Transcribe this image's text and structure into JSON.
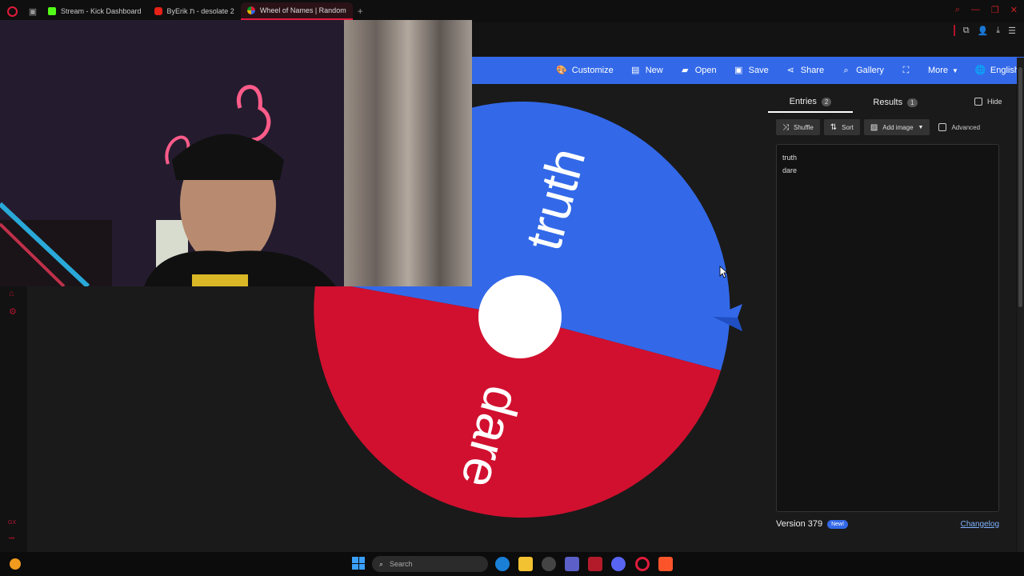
{
  "browser": {
    "tabs": [
      {
        "label": "Stream - Kick Dashboard",
        "favicon": "kick-icon",
        "active": false
      },
      {
        "label": "ByErik ת - desolate 2",
        "favicon": "youtube-icon",
        "active": false
      },
      {
        "label": "Wheel of Names | Random",
        "favicon": "wheel-of-names-icon",
        "active": true
      }
    ],
    "accent_color": "#e11b3c"
  },
  "navbar": {
    "background": "#3369e8",
    "items": [
      {
        "label": "Customize",
        "icon": "palette-icon"
      },
      {
        "label": "New",
        "icon": "file-icon"
      },
      {
        "label": "Open",
        "icon": "folder-open-icon"
      },
      {
        "label": "Save",
        "icon": "floppy-disk-icon"
      },
      {
        "label": "Share",
        "icon": "share-icon"
      },
      {
        "label": "Gallery",
        "icon": "search-icon"
      },
      {
        "label": "",
        "icon": "fullscreen-icon"
      },
      {
        "label": "More",
        "icon": "caret-down-icon"
      },
      {
        "label": "English",
        "icon": "globe-icon"
      }
    ]
  },
  "wheel": {
    "segments": [
      {
        "label": "truth",
        "color": "#3369e8"
      },
      {
        "label": "dare",
        "color": "#d1102f"
      }
    ],
    "center_color": "#ffffff",
    "pointer_color": "#3369e8"
  },
  "panel": {
    "tabs": [
      {
        "label": "Entries",
        "count": "2"
      },
      {
        "label": "Results",
        "count": "1"
      }
    ],
    "hide_label": "Hide",
    "tools": {
      "shuffle": "Shuffle",
      "sort": "Sort",
      "add_image": "Add image",
      "advanced": "Advanced"
    },
    "entries": [
      "truth",
      "dare"
    ],
    "version": "Version 379",
    "new_badge": "New!",
    "changelog": "Changelog"
  },
  "taskbar": {
    "search_placeholder": "Search"
  }
}
